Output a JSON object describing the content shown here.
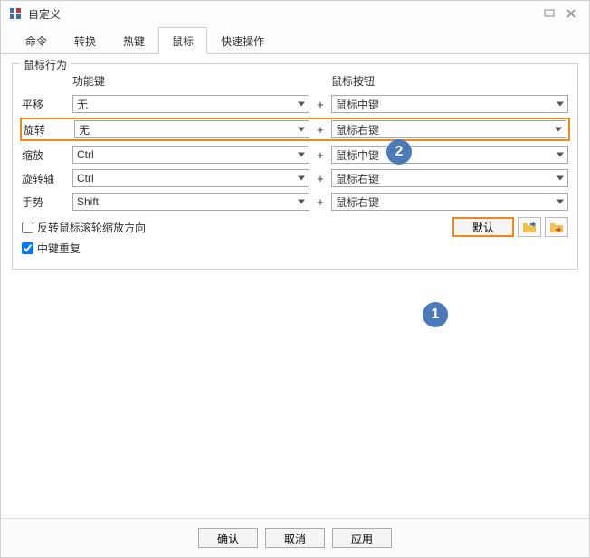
{
  "window": {
    "title": "自定义"
  },
  "tabs": {
    "items": [
      "命令",
      "转换",
      "热键",
      "鼠标",
      "快速操作"
    ],
    "active": 3
  },
  "fieldset": {
    "legend": "鼠标行为",
    "header_funckey": "功能键",
    "header_mousebtn": "鼠标按钮",
    "plus": "+",
    "rows": [
      {
        "label": "平移",
        "funckey": "无",
        "mousebtn": "鼠标中键"
      },
      {
        "label": "旋转",
        "funckey": "无",
        "mousebtn": "鼠标右键"
      },
      {
        "label": "缩放",
        "funckey": "Ctrl",
        "mousebtn": "鼠标中键"
      },
      {
        "label": "旋转轴",
        "funckey": "Ctrl",
        "mousebtn": "鼠标右键"
      },
      {
        "label": "手势",
        "funckey": "Shift",
        "mousebtn": "鼠标右键"
      }
    ],
    "reverse_wheel": "反转鼠标滚轮缩放方向",
    "middle_repeat": "中键重复",
    "default_btn": "默认"
  },
  "buttons": {
    "ok": "确认",
    "cancel": "取消",
    "apply": "应用"
  },
  "badges": {
    "one": "1",
    "two": "2"
  }
}
